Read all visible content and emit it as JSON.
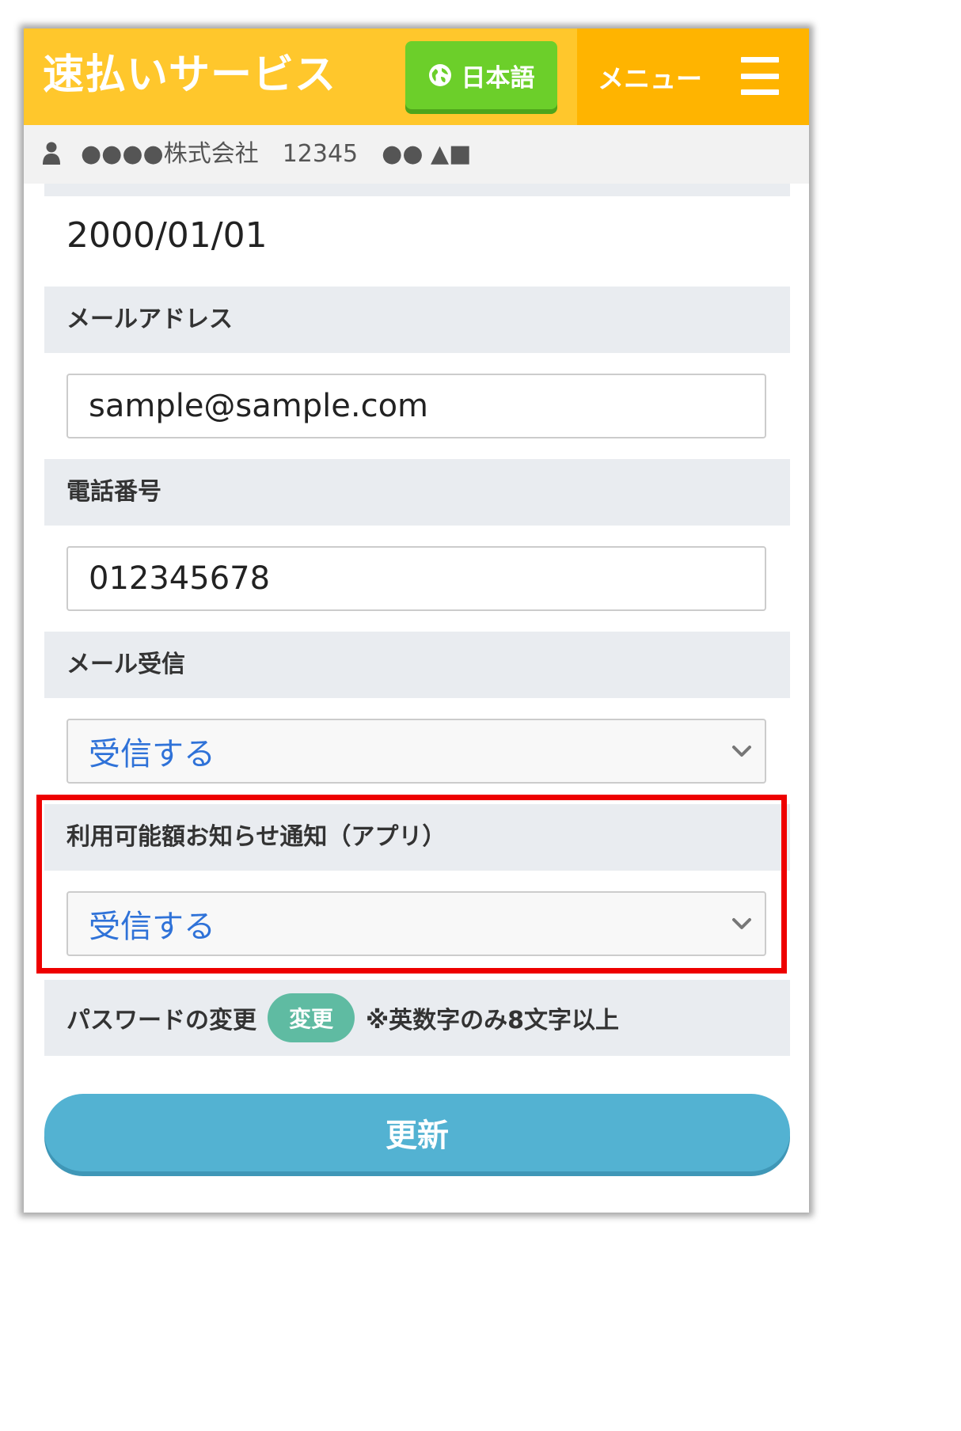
{
  "header": {
    "title": "速払いサービス",
    "language_button_label": "日本語",
    "menu_label": "メニュー"
  },
  "user_bar": {
    "user_info": "●●●●株式会社　12345　●● ▲■"
  },
  "form": {
    "birthdate_value": "2000/01/01",
    "email": {
      "label": "メールアドレス",
      "value": "sample@sample.com"
    },
    "phone": {
      "label": "電話番号",
      "value": "012345678"
    },
    "mail_receive": {
      "label": "メール受信",
      "selected": "受信する"
    },
    "app_notification": {
      "label": "利用可能額お知らせ通知（アプリ）",
      "selected": "受信する"
    },
    "password": {
      "label": "パスワードの変更",
      "button_label": "変更",
      "note": "※英数字のみ8文字以上"
    },
    "submit_label": "更新"
  },
  "colors": {
    "header_bg": "#ffc72c",
    "menu_bg": "#ffb400",
    "language_button_bg": "#6ccf2a",
    "section_label_bg": "#e9ecf0",
    "select_text": "#2f72d8",
    "password_button_bg": "#5fbba2",
    "submit_bg": "#53b2d2",
    "highlight_border": "#ee0000"
  },
  "icons": {
    "language": "globe-icon",
    "menu": "hamburger-icon",
    "user": "user-icon",
    "select": "chevron-down-icon"
  }
}
